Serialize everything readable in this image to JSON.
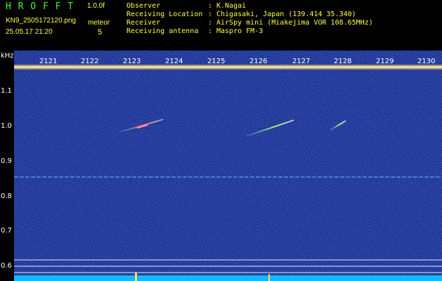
{
  "header": {
    "logo": "H R O F F T",
    "version": "1.0.0f",
    "filename": "KN9_2505172120.png",
    "label_meteor": "meteor",
    "meteor_count": "5",
    "datetime": "25.05.17 21:20",
    "info": [
      {
        "key": "Observer",
        "sep": ":",
        "value": "K.Nagai"
      },
      {
        "key": "Receiving Location",
        "sep": ":",
        "value": "Chigasaki, Japan (139.414 35.340)"
      },
      {
        "key": "Receiver",
        "sep": ":",
        "value": "AirSpy mini (Miakejima VOR 108.65MHz)"
      },
      {
        "key": "Receiving antenna",
        "sep": ":",
        "value": "Maspro FM-3"
      }
    ]
  },
  "axes": {
    "y_unit": "kHz",
    "y_ticks": [
      "1.1",
      "1.0",
      "0.9",
      "0.8",
      "0.7",
      "0.6"
    ],
    "x_ticks": [
      "2121",
      "2122",
      "2123",
      "2124",
      "2125",
      "2126",
      "2127",
      "2128",
      "2129",
      "2130"
    ]
  },
  "colors": {
    "background": "#000000",
    "spectrogram": "#0a1a8c",
    "text_green": "#33ff33",
    "text_yellow": "#ffff44"
  }
}
